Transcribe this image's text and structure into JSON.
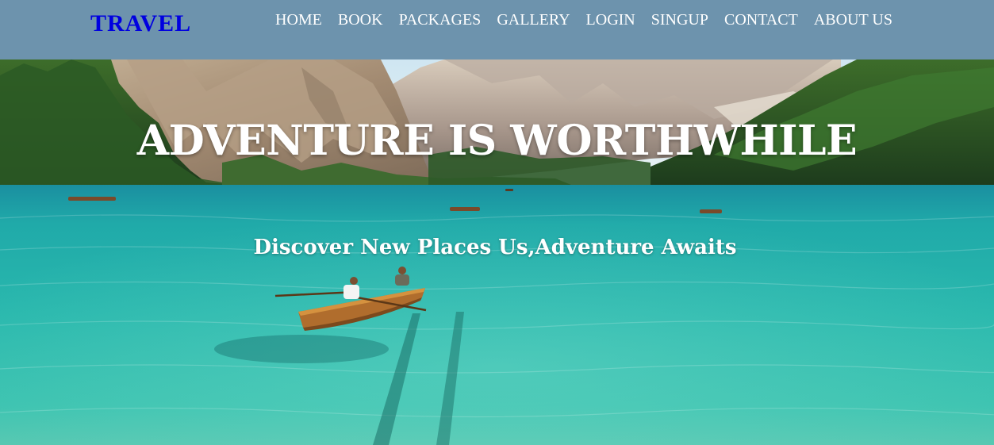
{
  "header": {
    "logo": "TRAVEL",
    "nav": [
      {
        "label": "HOME"
      },
      {
        "label": "BOOK"
      },
      {
        "label": "PACKAGES"
      },
      {
        "label": "GALLERY"
      },
      {
        "label": "LOGIN"
      },
      {
        "label": "SINGUP"
      },
      {
        "label": "CONTACT"
      },
      {
        "label": "ABOUT US"
      }
    ]
  },
  "hero": {
    "headline": "ADVENTURE IS WORTHWHILE",
    "subheadline": "Discover New Places Us,Adventure Awaits",
    "image_subject": "mountain-lake-with-rowboats"
  },
  "colors": {
    "header_bg": "#6d93ad",
    "logo": "#0000e0",
    "nav_text": "#ffffff",
    "hero_text": "#ffffff",
    "water": "#1fb3ac"
  }
}
